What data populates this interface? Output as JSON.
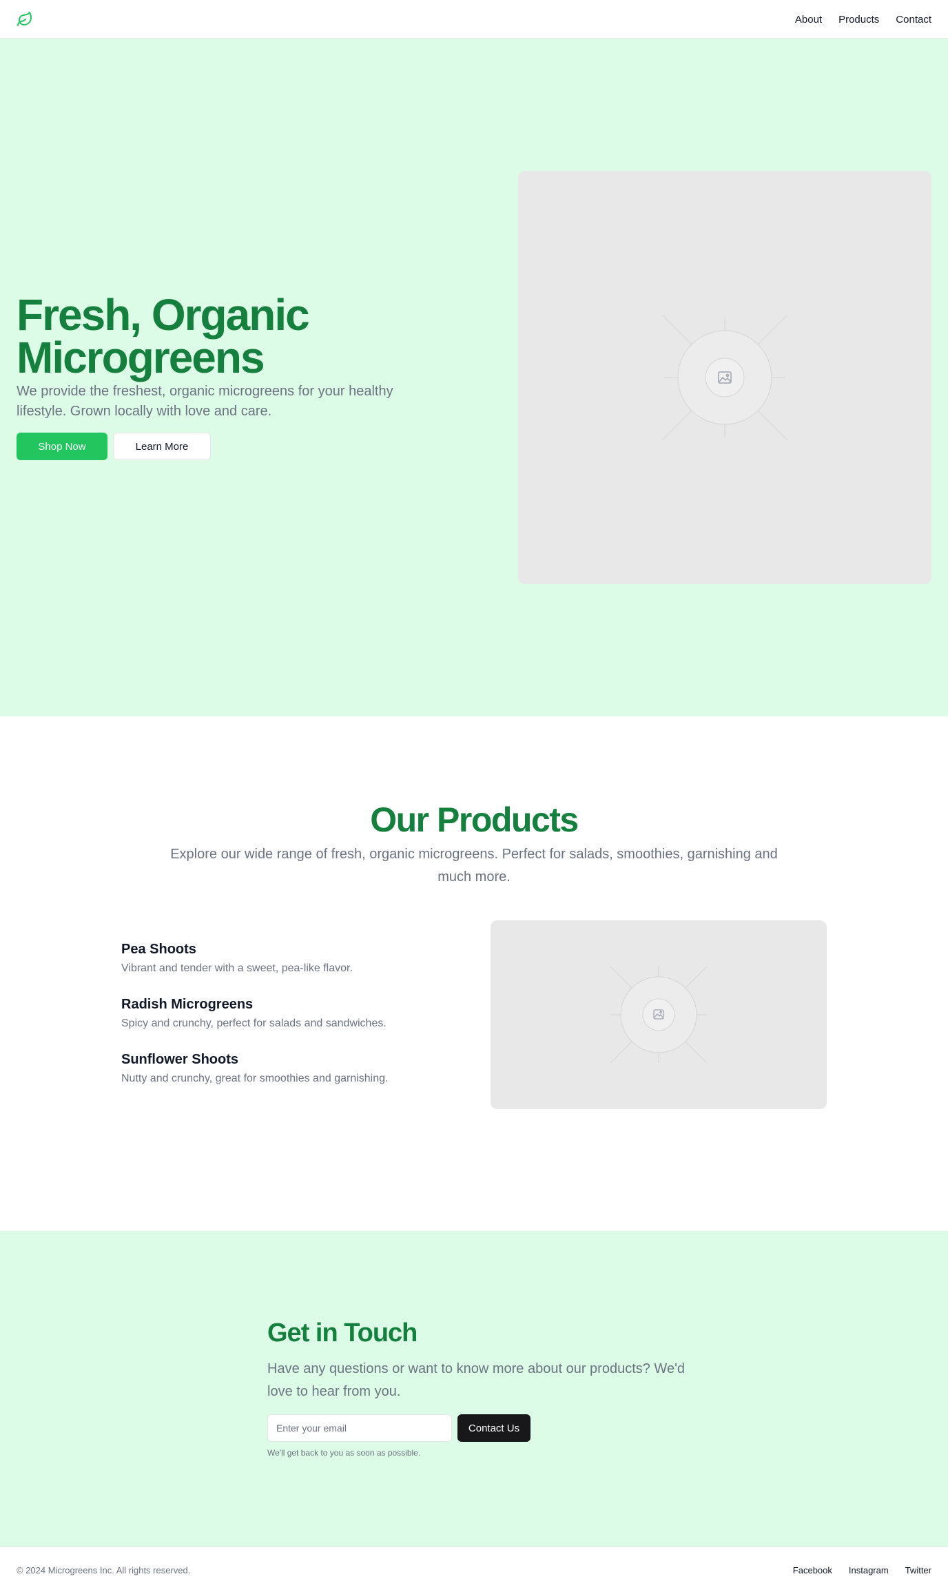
{
  "header": {
    "logo_icon": "leaf-icon",
    "nav": [
      {
        "label": "About"
      },
      {
        "label": "Products"
      },
      {
        "label": "Contact"
      }
    ]
  },
  "hero": {
    "title": "Fresh, Organic Microgreens",
    "text": "We provide the freshest, organic microgreens for your healthy lifestyle. Grown locally with love and care.",
    "primary_button": "Shop Now",
    "secondary_button": "Learn More",
    "image_icon": "image-placeholder-icon"
  },
  "products": {
    "title": "Our Products",
    "text": "Explore our wide range of fresh, organic microgreens. Perfect for salads, smoothies, garnishing and much more.",
    "items": [
      {
        "name": "Pea Shoots",
        "description": "Vibrant and tender with a sweet, pea-like flavor."
      },
      {
        "name": "Radish Microgreens",
        "description": "Spicy and crunchy, perfect for salads and sandwiches."
      },
      {
        "name": "Sunflower Shoots",
        "description": "Nutty and crunchy, great for smoothies and garnishing."
      }
    ],
    "image_icon": "image-placeholder-icon"
  },
  "contact": {
    "title": "Get in Touch",
    "text": "Have any questions or want to know more about our products? We'd love to hear from you.",
    "email_placeholder": "Enter your email",
    "email_value": "",
    "button": "Contact Us",
    "note": "We'll get back to you as soon as possible."
  },
  "footer": {
    "copyright": "© 2024 Microgreens Inc. All rights reserved.",
    "links": [
      {
        "label": "Facebook"
      },
      {
        "label": "Instagram"
      },
      {
        "label": "Twitter"
      }
    ]
  },
  "colors": {
    "brand_green": "#15803d",
    "accent_green": "#22c55e",
    "mint_background": "#dcfce7",
    "dark_button": "#18181b",
    "placeholder_gray": "#e8e8e8"
  }
}
